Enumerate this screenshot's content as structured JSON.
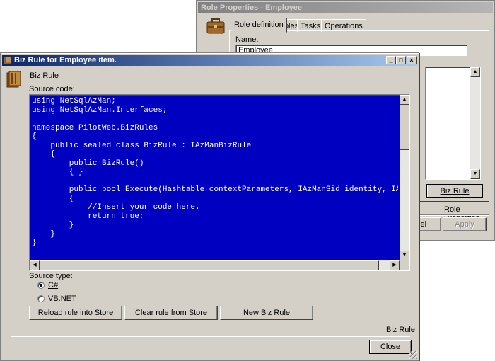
{
  "role_window": {
    "title": "Role Properties - Employee",
    "tabs": [
      "Role definition",
      "Roles",
      "Tasks",
      "Operations"
    ],
    "name_label": "Name:",
    "name_value": "Employee",
    "biz_rule_button": "Biz Rule",
    "footer_label": "Role Properties",
    "cancel_button": "ncel",
    "apply_button": "Apply"
  },
  "biz_window": {
    "title": "Biz Rule for Employee item.",
    "header_label": "Biz Rule",
    "source_code_label": "Source code:",
    "code_lines": [
      "using NetSqlAzMan;",
      "using NetSqlAzMan.Interfaces;",
      "",
      "namespace PilotWeb.BizRules",
      "{",
      "    public sealed class BizRule : IAzManBizRule",
      "    {",
      "        public BizRule()",
      "        { }",
      "",
      "        public bool Execute(Hashtable contextParameters, IAzManSid identity, IAzMan",
      "        {",
      "            //Insert your code here.",
      "            return true;",
      "        }",
      "    }",
      "}"
    ],
    "source_type_label": "Source type:",
    "radio_csharp": "C#",
    "radio_vbnet": "VB.NET",
    "selected_source_type": "C#",
    "reload_button": "Reload rule into Store",
    "clear_button": "Clear rule from Store",
    "new_button": "New Biz Rule",
    "footer_label": "Biz Rule",
    "close_button": "Close",
    "window_controls": {
      "minimize": "_",
      "maximize": "□",
      "close": "×"
    }
  }
}
